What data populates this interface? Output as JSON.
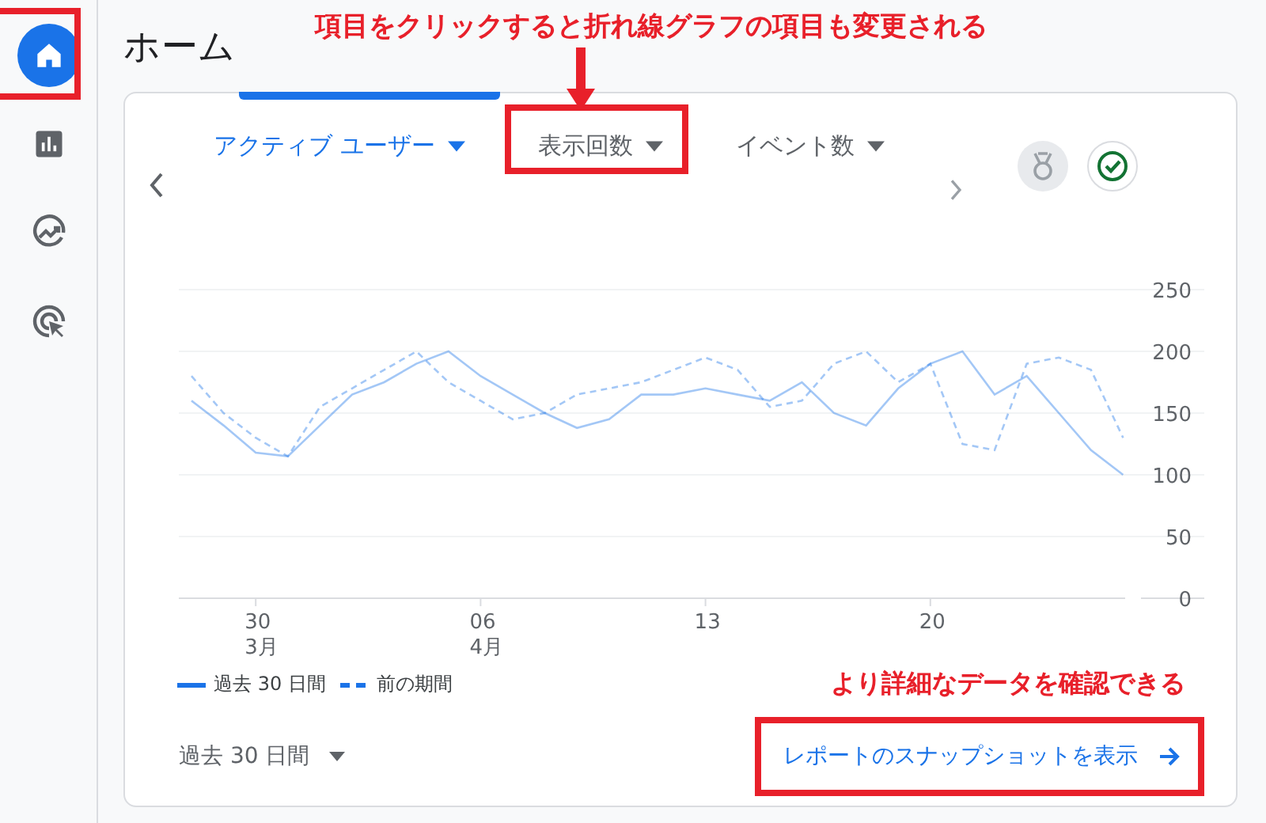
{
  "sidebar": {
    "items": [
      {
        "kind": "home",
        "selected": true
      },
      {
        "kind": "reports",
        "selected": false
      },
      {
        "kind": "explore",
        "selected": false
      },
      {
        "kind": "advertising",
        "selected": false
      }
    ]
  },
  "page": {
    "title": "ホーム"
  },
  "annotations": [
    {
      "text": "項目をクリックすると折れ線グラフの項目も変更される"
    },
    {
      "text": "より詳細なデータを確認できる"
    }
  ],
  "card": {
    "metrics": [
      {
        "label": "アクティブ ユーザー",
        "selected": true,
        "highlighted": false
      },
      {
        "label": "表示回数",
        "selected": false,
        "highlighted": true
      },
      {
        "label": "イベント数",
        "selected": false,
        "highlighted": false
      }
    ],
    "chart_data": {
      "type": "line",
      "series": [
        {
          "name": "過去 30 日間",
          "color": "#1a73e8",
          "line_style": "solid",
          "values": [
            160,
            140,
            118,
            115,
            140,
            165,
            175,
            190,
            200,
            180,
            165,
            150,
            138,
            145,
            165,
            165,
            170,
            165,
            160,
            175,
            150,
            140,
            170,
            190,
            200,
            165,
            180,
            150,
            120,
            100
          ]
        },
        {
          "name": "前の期間",
          "color": "#1a73e8",
          "line_style": "dashed",
          "values": [
            180,
            150,
            130,
            115,
            155,
            170,
            185,
            200,
            175,
            160,
            145,
            150,
            165,
            170,
            175,
            185,
            195,
            185,
            155,
            160,
            190,
            200,
            175,
            190,
            125,
            120,
            190,
            195,
            185,
            130
          ]
        }
      ],
      "ylim": [
        0,
        250
      ],
      "yticks": [
        0,
        50,
        100,
        150,
        200,
        250
      ],
      "grid": true
    },
    "x_axis_labels": [
      {
        "day": "30",
        "month": "3月"
      },
      {
        "day": "06",
        "month": "4月"
      },
      {
        "day": "13"
      },
      {
        "day": "20"
      }
    ],
    "date_range": "過去 30 日間",
    "link": {
      "label": "レポートのスナップショットを表示",
      "highlighted": true
    }
  }
}
